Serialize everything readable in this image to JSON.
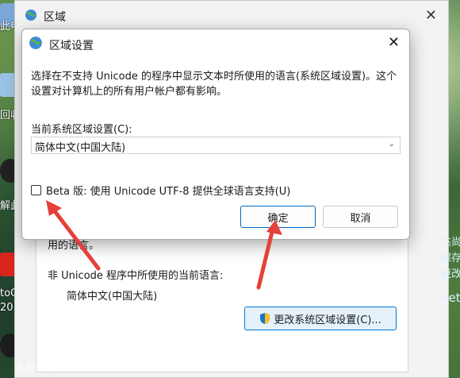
{
  "desktop": {
    "labels": [
      "此电",
      "回收",
      "解此",
      "toCo",
      "20"
    ],
    "side_links": [
      "杰尚",
      "保存",
      "更改",
      "net"
    ],
    "watermark": "大数据猎"
  },
  "outer_window": {
    "title": "区域",
    "partial_text": "用的语言。",
    "nonunicode_label": "非 Unicode 程序中所使用的当前语言:",
    "current_language": "简体中文(中国大陆)",
    "change_button": "更改系统区域设置(C)..."
  },
  "dialog": {
    "title": "区域设置",
    "description": "选择在不支持 Unicode 的程序中显示文本时所使用的语言(系统区域设置)。这个设置对计算机上的所有用户帐户都有影响。",
    "field_label": "当前系统区域设置(C):",
    "selected_locale": "简体中文(中国大陆)",
    "beta_label": "Beta 版: 使用 Unicode UTF-8 提供全球语言支持(U)",
    "beta_checked": false,
    "ok_button": "确定",
    "cancel_button": "取消"
  },
  "colors": {
    "accent": "#0067c0",
    "arrow": "#e5403a"
  }
}
